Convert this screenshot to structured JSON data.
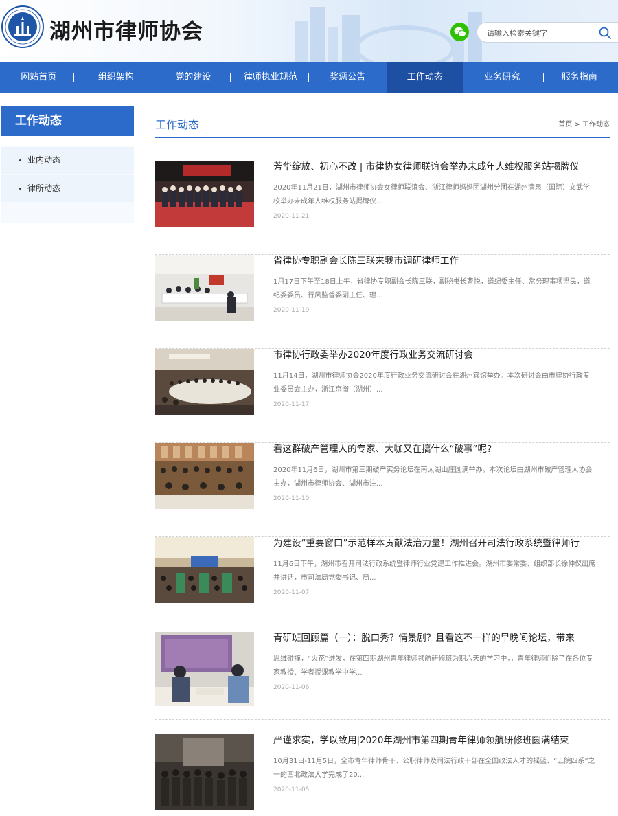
{
  "header": {
    "site_title": "湖州市律师协会",
    "search_placeholder": "请输入检索关键字",
    "brand_color": "#2c6bc9"
  },
  "nav": {
    "items": [
      {
        "label": "网站首页"
      },
      {
        "label": "组织架构"
      },
      {
        "label": "党的建设"
      },
      {
        "label": "律师执业规范"
      },
      {
        "label": "奖惩公告"
      },
      {
        "label": "工作动态",
        "active": true
      },
      {
        "label": "业务研究"
      },
      {
        "label": "服务指南"
      }
    ]
  },
  "sidebar": {
    "title": "工作动态",
    "items": [
      {
        "label": "业内动态"
      },
      {
        "label": "律所动态"
      }
    ]
  },
  "main": {
    "title": "工作动态",
    "breadcrumb": "首页 > 工作动态"
  },
  "articles": [
    {
      "title": "芳华绽放、初心不改 | 市律协女律师联谊会举办未成年人维权服务站揭牌仪",
      "summary": "2020年11月21日，湖州市律师协会女律师联谊会、浙江律师妈妈团湖州分团在湖州清泉（国际）文武学校举办未成年人维权服务站揭牌仪...",
      "date": "2020-11-21"
    },
    {
      "title": "省律协专职副会长陈三联来我市调研律师工作",
      "summary": "1月17日下午至18日上午，省律协专职副会长陈三联，副秘书长曹悦，道纪委主任、常务理事项坚民，道纪委委员、行风监督委副主任、理...",
      "date": "2020-11-19"
    },
    {
      "title": "市律协行政委举办2020年度行政业务交流研讨会",
      "summary": "11月14日，湖州市律师协会2020年度行政业务交流研讨会在湖州宾馆举办。本次研讨会由市律协行政专业委员会主办，浙江京衡（湖州）...",
      "date": "2020-11-17"
    },
    {
      "title": "看这群破产管理人的专家、大咖又在搞什么“破事”呢?",
      "summary": "2020年11月6日，湖州市第三期破产实务论坛在南太湖山庄圆满举办。本次论坛由湖州市破产管理人协会主办，湖州市律师协会、湖州市注...",
      "date": "2020-11-10"
    },
    {
      "title": "为建设“重要窗口”示范样本贡献法治力量！湖州召开司法行政系统暨律师行",
      "summary": "11月6日下午，湖州市召开司法行政系统暨律师行业党建工作推进会。湖州市委常委、组织部长徐仲仪出席并讲话，市司法局党委书记、局...",
      "date": "2020-11-07"
    },
    {
      "title": "青研班回顾篇（一）：脱口秀？情景剧？且看这不一样的早晚间论坛，带来",
      "summary": "思维碰撞，“火花”迸发，在第四期湖州青年律师领航研修班为期六天的学习中，，青年律师们除了在各位专家教授、学者授课教学中学...",
      "date": "2020-11-06"
    },
    {
      "title": "严谨求实，学以致用|2020年湖州市第四期青年律师领航研修班圆满结束",
      "summary": "10月31日-11月5日，全市青年律师骨干、公职律师及司法行政干部在全国政法人才的摇篮、“五院四系”之一的西北政法大学完成了20...",
      "date": "2020-11-05"
    }
  ]
}
